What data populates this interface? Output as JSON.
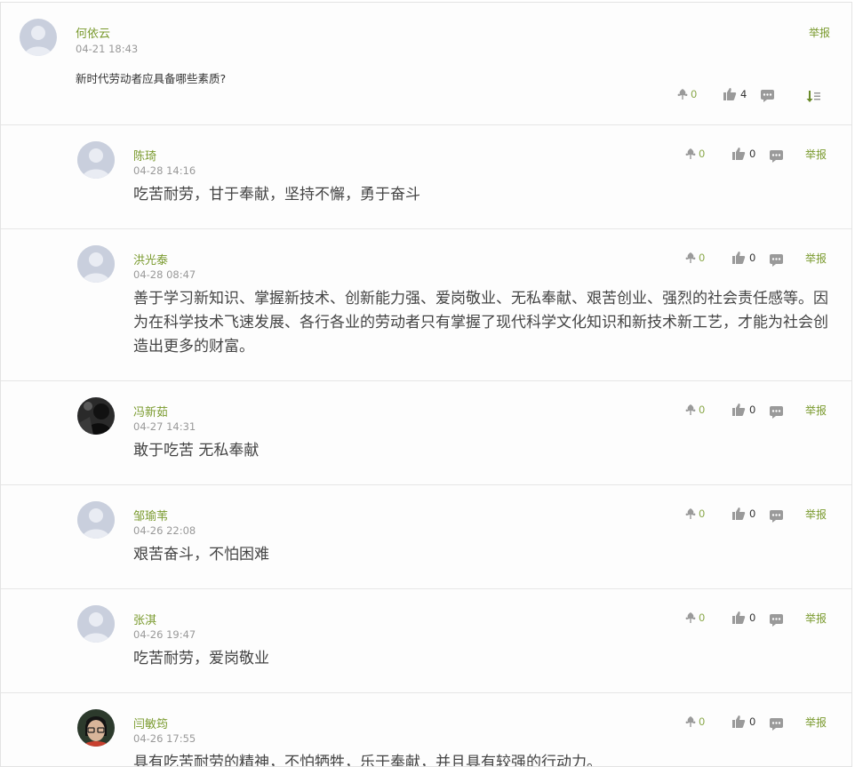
{
  "question": {
    "author": "何依云",
    "time": "04-21 18:43",
    "text": "新时代劳动者应具备哪些素质?",
    "report": "举报",
    "flowers": "0",
    "likes": "4"
  },
  "replies": [
    {
      "author": "陈琦",
      "time": "04-28 14:16",
      "text": "吃苦耐劳，甘于奉献，坚持不懈，勇于奋斗",
      "flowers": "0",
      "likes": "0",
      "report": "举报",
      "avatar": "default"
    },
    {
      "author": "洪光泰",
      "time": "04-28 08:47",
      "text": "善于学习新知识、掌握新技术、创新能力强、爱岗敬业、无私奉献、艰苦创业、强烈的社会责任感等。因为在科学技术飞速发展、各行各业的劳动者只有掌握了现代科学文化知识和新技术新工艺，才能为社会创造出更多的财富。",
      "flowers": "0",
      "likes": "0",
      "report": "举报",
      "avatar": "default"
    },
    {
      "author": "冯新茹",
      "time": "04-27 14:31",
      "text": "敢于吃苦 无私奉献",
      "flowers": "0",
      "likes": "0",
      "report": "举报",
      "avatar": "photo-dark"
    },
    {
      "author": "邹瑜苇",
      "time": "04-26 22:08",
      "text": "艰苦奋斗，不怕困难",
      "flowers": "0",
      "likes": "0",
      "report": "举报",
      "avatar": "default"
    },
    {
      "author": "张淇",
      "time": "04-26 19:47",
      "text": "吃苦耐劳，爱岗敬业",
      "flowers": "0",
      "likes": "0",
      "report": "举报",
      "avatar": "default"
    },
    {
      "author": "闫敏筠",
      "time": "04-26 17:55",
      "text": "具有吃苦耐劳的精神，不怕牺牲，乐于奉献，并且具有较强的行动力。",
      "flowers": "0",
      "likes": "0",
      "report": "举报",
      "avatar": "photo-glasses"
    }
  ],
  "icons": {
    "flower": "flower-icon",
    "like": "thumbs-up-icon",
    "comment": "comment-icon",
    "sort": "sort-icon"
  },
  "colors": {
    "accent": "#7a9a2e",
    "flower": "#8aa84a",
    "icon_gray": "#9a9a9a",
    "avatar_default": "#c9cfdd"
  }
}
